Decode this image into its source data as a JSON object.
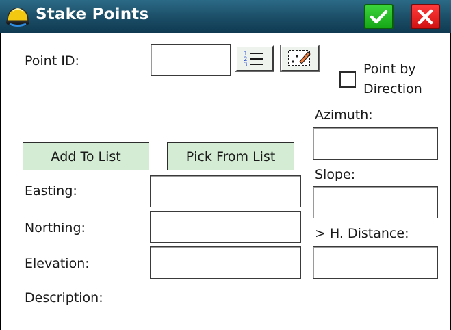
{
  "window": {
    "title": "Stake Points",
    "ok_label": "✓",
    "close_label": "✕"
  },
  "colors": {
    "titlebar": "#1b4d66",
    "ok": "#16a616",
    "close": "#d11212",
    "action_button": "#d3ecd3"
  },
  "form": {
    "point_id_label": "Point ID:",
    "point_id_value": "",
    "list_tool_icon": "numbered-list-icon",
    "map_tool_icon": "map-select-icon",
    "point_by_direction_line1": "Point by",
    "point_by_direction_line2": "Direction",
    "point_by_direction_checked": false,
    "add_to_list": {
      "accel": "A",
      "rest": "dd To List"
    },
    "pick_from_list": {
      "accel": "P",
      "rest": "ick From List"
    },
    "easting_label": "Easting:",
    "easting_value": "",
    "northing_label": "Northing:",
    "northing_value": "",
    "elevation_label": "Elevation:",
    "elevation_value": "",
    "description_label": "Description:",
    "azimuth_label": "Azimuth:",
    "azimuth_value": "",
    "slope_label": "Slope:",
    "slope_value": "",
    "hdistance_label": "> H. Distance:",
    "hdistance_value": ""
  }
}
